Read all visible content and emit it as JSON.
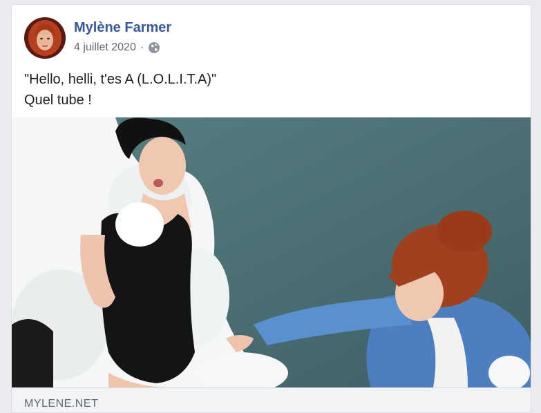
{
  "post": {
    "author": "Mylène Farmer",
    "date": "4 juillet 2020",
    "separator": "·",
    "privacy_icon": "globe-icon",
    "text_line1": "\"Hello, helli, t'es A (L.O.L.I.T.A)\"",
    "text_line2": "Quel tube !"
  },
  "link_preview": {
    "domain": "MYLENE.NET"
  },
  "colors": {
    "author_link": "#385898",
    "background": "#e9ebee",
    "card": "#ffffff"
  }
}
